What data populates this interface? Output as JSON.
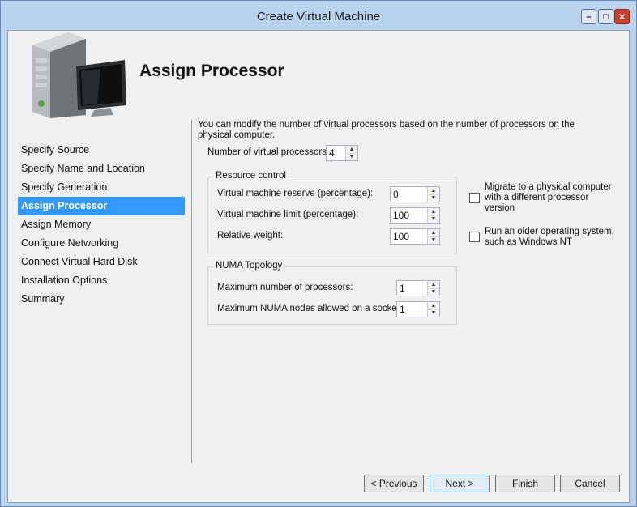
{
  "window": {
    "title": "Create Virtual Machine"
  },
  "header": {
    "heading": "Assign Processor"
  },
  "nav": {
    "items": [
      {
        "label": "Specify Source"
      },
      {
        "label": "Specify Name and Location"
      },
      {
        "label": "Specify Generation"
      },
      {
        "label": "Assign Processor"
      },
      {
        "label": "Assign Memory"
      },
      {
        "label": "Configure Networking"
      },
      {
        "label": "Connect Virtual Hard Disk"
      },
      {
        "label": "Installation Options"
      },
      {
        "label": "Summary"
      }
    ],
    "selected_index": 3
  },
  "content": {
    "description": "You can modify the number of virtual processors based on the number of processors on the physical computer.",
    "num_processors_label": "Number of virtual processors:",
    "num_processors_value": "4",
    "resource_control": {
      "title": "Resource control",
      "reserve_label": "Virtual machine reserve (percentage):",
      "reserve_value": "0",
      "limit_label": "Virtual machine limit (percentage):",
      "limit_value": "100",
      "weight_label": "Relative weight:",
      "weight_value": "100"
    },
    "numa": {
      "title": "NUMA Topology",
      "max_processors_label": "Maximum number of processors:",
      "max_processors_value": "1",
      "max_nodes_label": "Maximum NUMA nodes allowed on a socket:",
      "max_nodes_value": "1"
    },
    "migrate_checkbox": {
      "label": "Migrate to a physical computer with a different processor version",
      "checked": false
    },
    "older_os_checkbox": {
      "label": "Run an older operating system, such as Windows NT",
      "checked": false
    }
  },
  "buttons": {
    "previous": "< Previous",
    "next": "Next >",
    "finish": "Finish",
    "cancel": "Cancel"
  },
  "icons": {
    "minimize": "minimize-icon",
    "maximize": "maximize-icon",
    "close": "close-icon",
    "server": "server-computer-icon"
  },
  "colors": {
    "selected_nav_bg": "#3399ff",
    "close_button": "#c7432e",
    "title_bar": "#bad3ee"
  }
}
